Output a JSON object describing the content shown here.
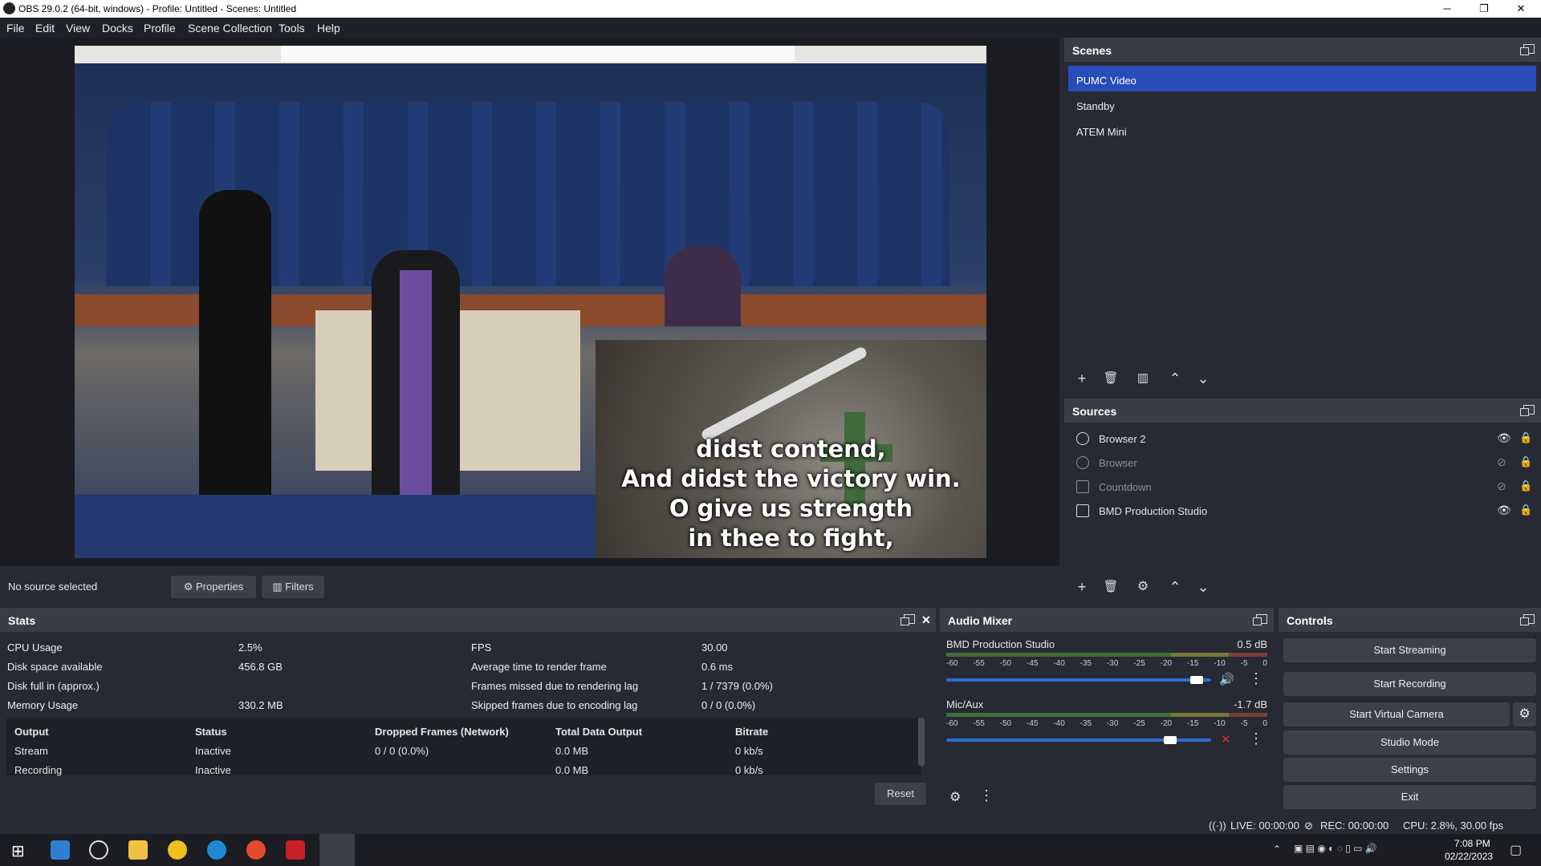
{
  "window": {
    "title": "OBS 29.0.2 (64-bit, windows) - Profile: Untitled - Scenes: Untitled"
  },
  "menu": [
    "File",
    "Edit",
    "View",
    "Docks",
    "Profile",
    "Scene Collection",
    "Tools",
    "Help"
  ],
  "preview": {
    "lyrics": [
      "didst contend,",
      "And didst the victory win.",
      "O give us strength",
      "in thee to fight,"
    ]
  },
  "source_toolbar": {
    "no_source": "No source selected",
    "properties_label": "Properties",
    "filters_label": "Filters"
  },
  "scenes": {
    "title": "Scenes",
    "items": [
      {
        "label": "PUMC Video",
        "selected": true
      },
      {
        "label": "Standby",
        "selected": false
      },
      {
        "label": "ATEM Mini",
        "selected": false
      }
    ]
  },
  "sources": {
    "title": "Sources",
    "items": [
      {
        "label": "Browser 2",
        "visible": true,
        "icon": "browser-icon"
      },
      {
        "label": "Browser",
        "visible": false,
        "icon": "browser-icon"
      },
      {
        "label": "Countdown",
        "visible": false,
        "icon": "window-icon"
      },
      {
        "label": "BMD Production Studio",
        "visible": true,
        "icon": "camera-icon"
      }
    ]
  },
  "stats": {
    "title": "Stats",
    "rows_left": [
      {
        "label": "CPU Usage",
        "value": "2.5%"
      },
      {
        "label": "Disk space available",
        "value": "456.8 GB"
      },
      {
        "label": "Disk full in (approx.)",
        "value": ""
      },
      {
        "label": "Memory Usage",
        "value": "330.2 MB"
      }
    ],
    "rows_right": [
      {
        "label": "FPS",
        "value": "30.00"
      },
      {
        "label": "Average time to render frame",
        "value": "0.6 ms"
      },
      {
        "label": "Frames missed due to rendering lag",
        "value": "1 / 7379 (0.0%)"
      },
      {
        "label": "Skipped frames due to encoding lag",
        "value": "0 / 0 (0.0%)"
      }
    ],
    "output_headers": [
      "Output",
      "Status",
      "Dropped Frames (Network)",
      "Total Data Output",
      "Bitrate"
    ],
    "output_rows": [
      [
        "Stream",
        "Inactive",
        "0 / 0 (0.0%)",
        "0.0 MB",
        "0 kb/s"
      ],
      [
        "Recording",
        "Inactive",
        "",
        "0.0 MB",
        "0 kb/s"
      ]
    ],
    "reset_label": "Reset"
  },
  "mixer": {
    "title": "Audio Mixer",
    "tick_labels": [
      "-60",
      "-55",
      "-50",
      "-45",
      "-40",
      "-35",
      "-30",
      "-25",
      "-20",
      "-15",
      "-10",
      "-5",
      "0"
    ],
    "channels": [
      {
        "name": "BMD Production Studio",
        "db": "0.5 dB",
        "level": 0.97,
        "muted": false
      },
      {
        "name": "Mic/Aux",
        "db": "-1.7 dB",
        "level": 0.87,
        "muted": true
      }
    ]
  },
  "controls": {
    "title": "Controls",
    "buttons": [
      "Start Streaming",
      "Start Recording",
      "Start Virtual Camera",
      "Studio Mode",
      "Settings",
      "Exit"
    ]
  },
  "status": {
    "live": "LIVE: 00:00:00",
    "rec": "REC: 00:00:00",
    "cpu": "CPU: 2.8%, 30.00 fps"
  },
  "taskbar": {
    "time": "7:08 PM",
    "date": "02/22/2023"
  },
  "colors": {
    "selected": "#284cb8",
    "panel": "#272a33",
    "header": "#3a3d47",
    "button": "#3c404d"
  }
}
